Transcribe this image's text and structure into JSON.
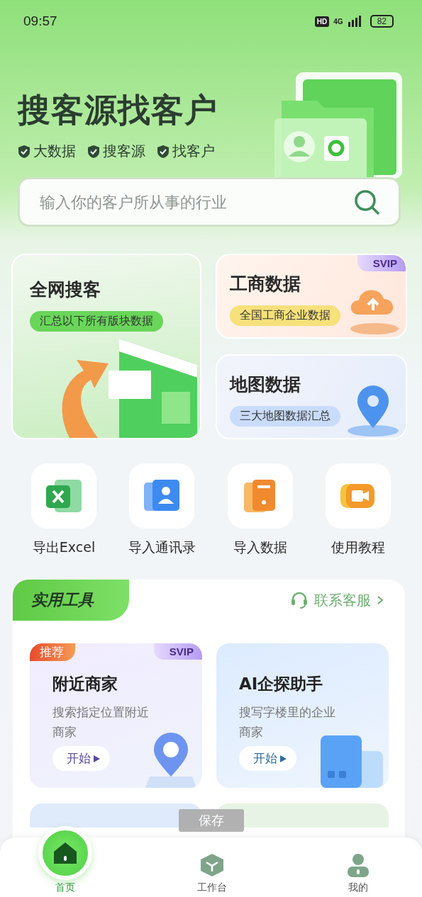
{
  "status_bar": {
    "time": "09:57",
    "hd": "HD",
    "network": "4G",
    "battery": "82"
  },
  "hero": {
    "title": "搜客源找客户",
    "tags": [
      "大数据",
      "搜客源",
      "找客户"
    ]
  },
  "search": {
    "placeholder": "输入你的客户所从事的行业"
  },
  "feature_cards": [
    {
      "kind": "large",
      "title": "全网搜客",
      "subtitle": "汇总以下所有版块数据",
      "svip": false
    },
    {
      "kind": "small",
      "title": "工商数据",
      "subtitle": "全国工商企业数据",
      "svip": true,
      "svip_label": "SVIP"
    },
    {
      "kind": "small",
      "title": "地图数据",
      "subtitle": "三大地图数据汇总",
      "svip": false
    }
  ],
  "quick_actions": [
    {
      "kind": "excel",
      "label": "导出Excel"
    },
    {
      "kind": "contacts",
      "label": "导入通讯录"
    },
    {
      "kind": "import",
      "label": "导入数据"
    },
    {
      "kind": "video",
      "label": "使用教程"
    }
  ],
  "tools": {
    "title": "实用工具",
    "service_link": "联系客服",
    "cards": [
      {
        "kind": "map",
        "title": "附近商家",
        "description": "搜索指定位置附近商家",
        "button": "开始",
        "badge": "推荐",
        "svip": true,
        "svip_label": "SVIP"
      },
      {
        "kind": "ai",
        "title": "AI企探助手",
        "description": "搜写字楼里的企业商家",
        "button": "开始",
        "svip": false
      }
    ]
  },
  "toast": "保存",
  "tab_bar": [
    {
      "kind": "home",
      "label": "首页",
      "selected": true
    },
    {
      "kind": "workbench",
      "label": "工作台",
      "selected": false
    },
    {
      "kind": "profile",
      "label": "我的",
      "selected": false
    }
  ]
}
